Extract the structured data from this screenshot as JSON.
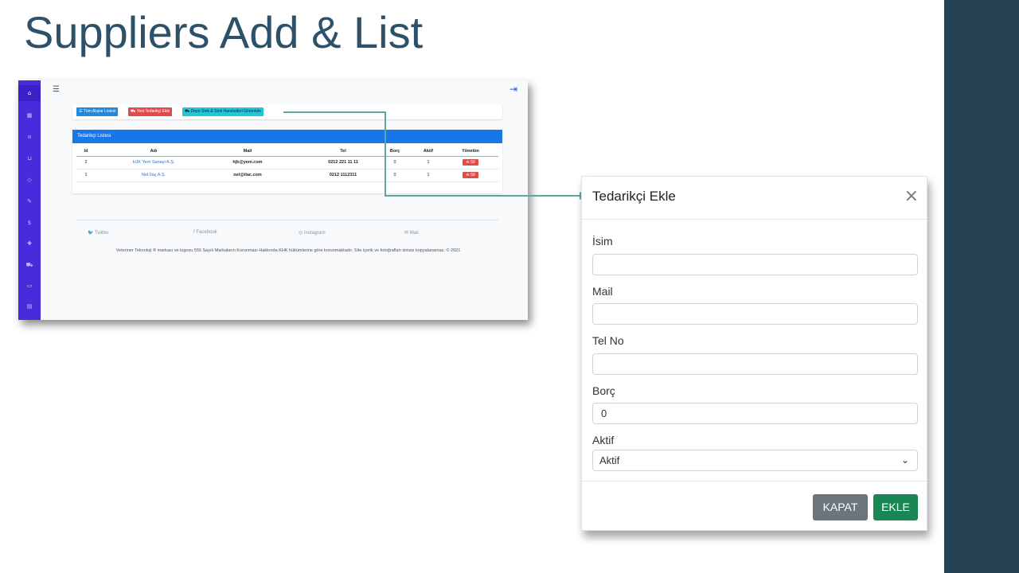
{
  "slide": {
    "title": "Suppliers Add & List"
  },
  "app": {
    "topbar": {
      "menu_icon": "hamburger-icon",
      "logout_icon": "logout-icon"
    },
    "sidebar_icons": [
      "home-icon",
      "dashboard-icon",
      "user-icon",
      "basket-icon",
      "tag-icon",
      "pencil-icon",
      "dollar-icon",
      "plus-icon",
      "truck-icon",
      "list-icon",
      "box-icon"
    ],
    "buttons": {
      "all_purchases": "☰ Tüm Alışlar Listesi",
      "new_supplier": "⛟ Yeni Tedarikçi Ekle",
      "third": "⛟ Depo Stok & Stok Hareketleri Görüntüle"
    },
    "table": {
      "title": "Tedarikçi Listesi",
      "headers": {
        "id": "Id",
        "adi": "Adı",
        "mail": "Mail",
        "tel": "Tel",
        "borc": "Borç",
        "aktif": "Aktif",
        "yonetim": "Yönetim"
      },
      "rows": [
        {
          "id": "2",
          "adi": "HJK Yem Sanayi A.Ş.",
          "mail": "hjk@yem.com",
          "tel": "0212 221 11 11",
          "borc": "0",
          "aktif": "1",
          "action": "⊖ Sil"
        },
        {
          "id": "1",
          "adi": "Net İlaç A.Ş.",
          "mail": "net@ilac.com",
          "tel": "0212 1112311",
          "borc": "0",
          "aktif": "1",
          "action": "⊖ Sil"
        }
      ]
    },
    "footer": {
      "twitter": "🐦 Twitter",
      "facebook": "f  Facebook",
      "instagram": "◎  Instagram",
      "mail": "✉  Mail",
      "copyright": "Veteriner Teknoloji ® markası ve logosu 556 Sayılı Markaların Korunması Hakkında KHK hükümlerine göre korunmaktadır. Site içerik ve fotoğrafları izinsiz kopyalanamaz. © 2021"
    }
  },
  "modal": {
    "title": "Tedarikçi Ekle",
    "close": "×",
    "fields": {
      "isim_label": "İsim",
      "isim_value": "",
      "mail_label": "Mail",
      "mail_value": "",
      "tel_label": "Tel No",
      "tel_value": "",
      "borc_label": "Borç",
      "borc_value": "0",
      "aktif_label": "Aktif",
      "aktif_selected": "Aktif"
    },
    "buttons": {
      "close_label": "KAPAT",
      "add_label": "EKLE"
    }
  },
  "colors": {
    "title": "#2c5168",
    "right_band": "#254353",
    "sidebar": "#4a2bdc",
    "table_header": "#1976e8",
    "connector": "#5aa89e",
    "add_button": "#198754",
    "close_button": "#6c757d",
    "delete_button": "#e34a4a"
  }
}
